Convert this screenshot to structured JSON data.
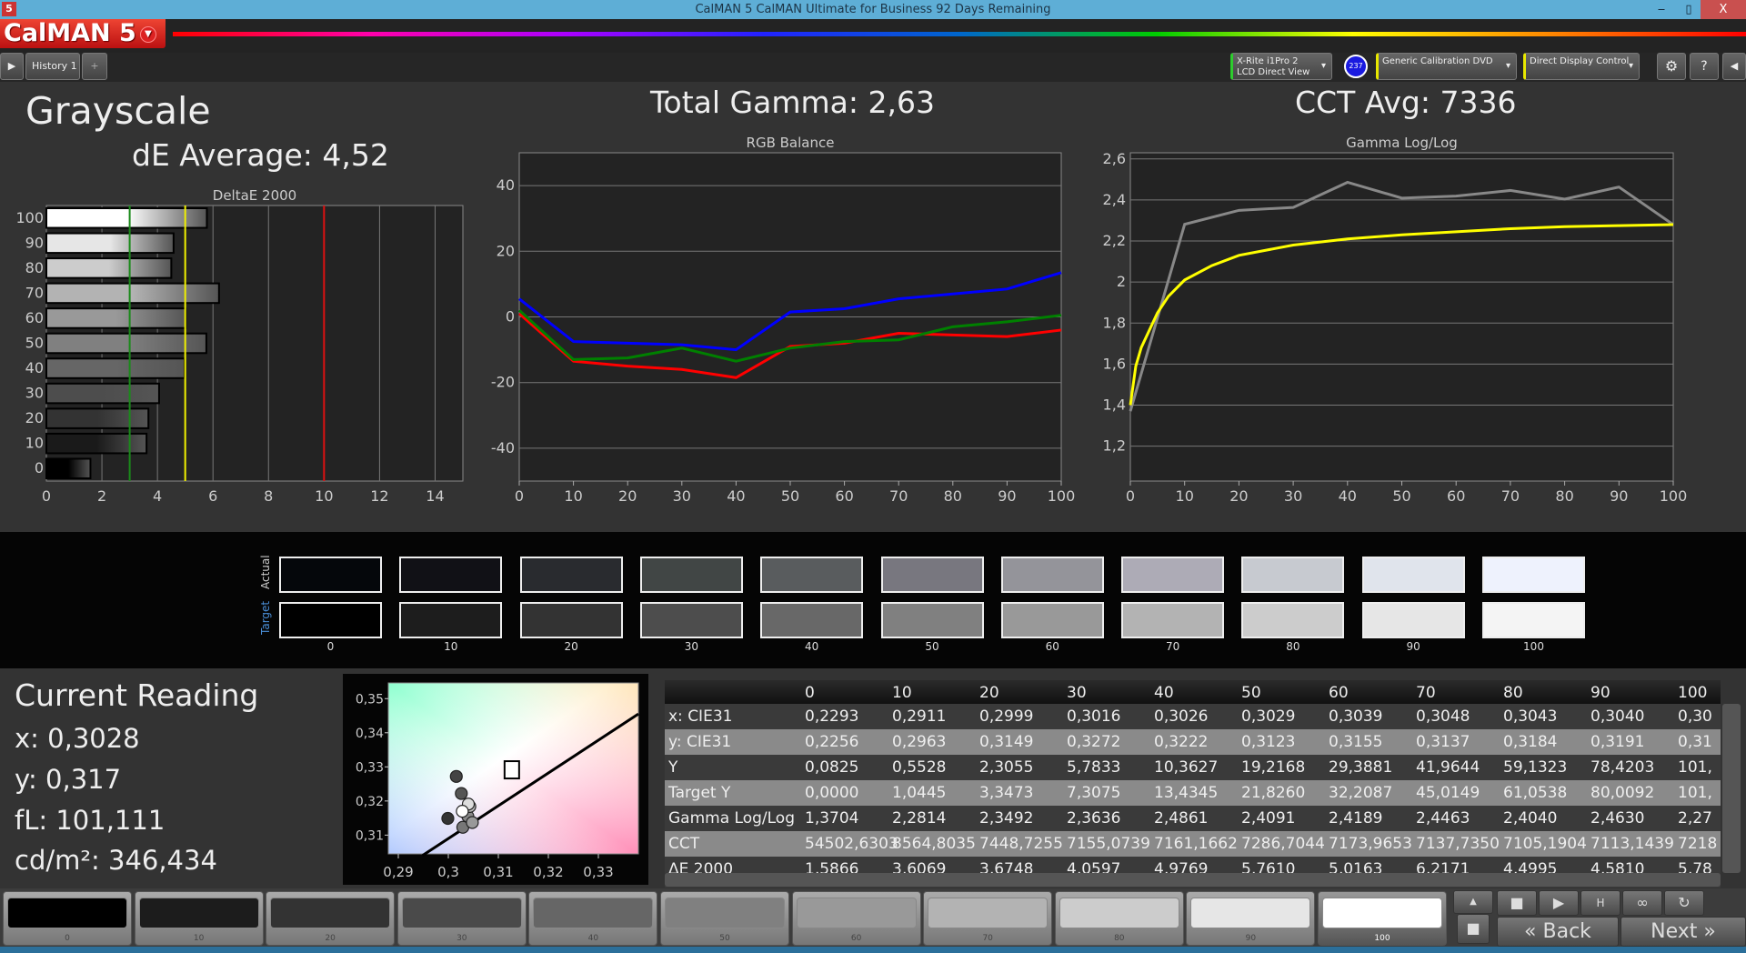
{
  "window": {
    "title": "CalMAN 5 CalMAN Ultimate for Business 92 Days Remaining",
    "app_icon": "5",
    "minimize": "‒",
    "restore": "▯",
    "close": "X"
  },
  "logo": {
    "text": "CalMAN 5",
    "menu_icon": "chevron-down"
  },
  "tabs": {
    "items": [
      {
        "label": "History 1"
      }
    ],
    "add": "+"
  },
  "toolbar": {
    "meter_line1": "X-Rite i1Pro 2",
    "meter_line2": "LCD Direct View",
    "meter_badge": "237",
    "source": "Generic Calibration DVD",
    "display": "Direct Display Control",
    "accent_meter": "#2ecc2e",
    "accent_source": "#e8e800",
    "accent_display": "#e8e800"
  },
  "header": {
    "page_title": "Grayscale",
    "de_average": "dE Average: 4,52",
    "total_gamma": "Total Gamma: 2,63",
    "cct_avg": "CCT Avg: 7336"
  },
  "chart_data": [
    {
      "type": "bar",
      "orientation": "horizontal",
      "title": "DeltaE 2000",
      "categories": [
        "0",
        "10",
        "20",
        "30",
        "40",
        "50",
        "60",
        "70",
        "80",
        "90",
        "100"
      ],
      "values": [
        1.5866,
        3.6069,
        3.6748,
        4.0597,
        4.9769,
        5.761,
        5.0163,
        6.2171,
        4.4995,
        4.581,
        5.78
      ],
      "xlim": [
        0,
        15
      ],
      "xticks": [
        "0",
        "2",
        "4",
        "6",
        "8",
        "10",
        "12",
        "14"
      ],
      "thresholds": [
        {
          "value": 3,
          "color": "#1a8a1a"
        },
        {
          "value": 5,
          "color": "#f0f000"
        },
        {
          "value": 10,
          "color": "#dd1111"
        }
      ],
      "grid": true
    },
    {
      "type": "line",
      "title": "RGB Balance",
      "x": [
        0,
        10,
        20,
        30,
        40,
        50,
        60,
        70,
        80,
        90,
        100
      ],
      "series": [
        {
          "color": "#ff0000",
          "values": [
            1,
            -13.5,
            -15,
            -16,
            -18.5,
            -9,
            -8,
            -5,
            -5.5,
            -6,
            -4
          ]
        },
        {
          "color": "#008000",
          "values": [
            2,
            -13,
            -12.5,
            -9.5,
            -13.5,
            -9.5,
            -7.5,
            -7,
            -3,
            -1.5,
            0.5
          ]
        },
        {
          "color": "#0000ff",
          "values": [
            5.5,
            -7.5,
            -8,
            -8.5,
            -10,
            1.5,
            2.5,
            5.5,
            7,
            8.5,
            13.5
          ]
        }
      ],
      "ylim": [
        -50,
        50
      ],
      "yticks": [
        "40",
        "20",
        "0",
        "-20",
        "-40"
      ],
      "xticks": [
        "0",
        "10",
        "20",
        "30",
        "40",
        "50",
        "60",
        "70",
        "80",
        "90",
        "100"
      ],
      "grid": true
    },
    {
      "type": "line",
      "title": "Gamma Log/Log",
      "series": [
        {
          "color": "#888888",
          "x": [
            0,
            10,
            20,
            30,
            40,
            50,
            60,
            70,
            80,
            90,
            100
          ],
          "values": [
            1.3704,
            2.2814,
            2.3492,
            2.3636,
            2.4861,
            2.4091,
            2.4189,
            2.4463,
            2.404,
            2.463,
            2.28
          ]
        },
        {
          "color": "#ffff00",
          "x": [
            0,
            1,
            2,
            5,
            7,
            10,
            15,
            20,
            30,
            40,
            50,
            60,
            70,
            80,
            90,
            100
          ],
          "values": [
            1.4,
            1.59,
            1.68,
            1.85,
            1.93,
            2.01,
            2.08,
            2.13,
            2.18,
            2.21,
            2.23,
            2.245,
            2.26,
            2.27,
            2.275,
            2.28
          ]
        }
      ],
      "ylim": [
        1.03,
        2.63
      ],
      "yticks": [
        "2,6",
        "2,4",
        "2,2",
        "2",
        "1,8",
        "1,6",
        "1,4",
        "1,2"
      ],
      "xticks": [
        "0",
        "10",
        "20",
        "30",
        "40",
        "50",
        "60",
        "70",
        "80",
        "90",
        "100"
      ],
      "grid": true
    },
    {
      "type": "scatter",
      "title": "",
      "xlim": [
        0.288,
        0.338
      ],
      "ylim": [
        0.3045,
        0.3546
      ],
      "xticks": [
        "0,29",
        "0,3",
        "0,31",
        "0,32",
        "0,33"
      ],
      "yticks": [
        "0,35",
        "0,34",
        "0,33",
        "0,32",
        "0,31"
      ],
      "points": [
        {
          "x": 0.2999,
          "y": 0.3149,
          "color": "#333333"
        },
        {
          "x": 0.3016,
          "y": 0.3272,
          "color": "#444444"
        },
        {
          "x": 0.3026,
          "y": 0.3222,
          "color": "#555555"
        },
        {
          "x": 0.3029,
          "y": 0.3123,
          "color": "#777777"
        },
        {
          "x": 0.3039,
          "y": 0.3155,
          "color": "#888888"
        },
        {
          "x": 0.3048,
          "y": 0.3137,
          "color": "#999999"
        },
        {
          "x": 0.3043,
          "y": 0.3184,
          "color": "#bbbbbb"
        },
        {
          "x": 0.304,
          "y": 0.3191,
          "color": "#dddddd"
        },
        {
          "x": 0.3028,
          "y": 0.317,
          "color": "#ffffff"
        }
      ],
      "target": {
        "x": 0.3127,
        "y": 0.329
      },
      "locus": [
        [
          0.2948,
          0.304
        ],
        [
          0.338,
          0.3455
        ]
      ]
    }
  ],
  "swatches": {
    "labels": [
      "Actual",
      "Target"
    ],
    "levels": [
      "0",
      "10",
      "20",
      "30",
      "40",
      "50",
      "60",
      "70",
      "80",
      "90",
      "100"
    ],
    "actual": [
      "#05070b",
      "#111116",
      "#292b2f",
      "#414645",
      "#595c5e",
      "#78777f",
      "#94949a",
      "#adabb6",
      "#c7cad0",
      "#e0e4ec",
      "#eef2fd"
    ],
    "target": [
      "#000000",
      "#1d1d1d",
      "#333333",
      "#4d4d4d",
      "#686868",
      "#808080",
      "#999999",
      "#b3b3b3",
      "#cccccc",
      "#e6e6e6",
      "#f4f4f4"
    ]
  },
  "reading": {
    "title": "Current Reading",
    "x": "x: 0,3028",
    "y": "y: 0,317",
    "fl": "fL: 101,111",
    "cdm2": "cd/m²: 346,434"
  },
  "table": {
    "columns": [
      "0",
      "10",
      "20",
      "30",
      "40",
      "50",
      "60",
      "70",
      "80",
      "90",
      "100"
    ],
    "rows": [
      {
        "label": "x: CIE31",
        "values": [
          "0,2293",
          "0,2911",
          "0,2999",
          "0,3016",
          "0,3026",
          "0,3029",
          "0,3039",
          "0,3048",
          "0,3043",
          "0,3040",
          "0,30"
        ]
      },
      {
        "label": "y: CIE31",
        "values": [
          "0,2256",
          "0,2963",
          "0,3149",
          "0,3272",
          "0,3222",
          "0,3123",
          "0,3155",
          "0,3137",
          "0,3184",
          "0,3191",
          "0,31"
        ]
      },
      {
        "label": "Y",
        "values": [
          "0,0825",
          "0,5528",
          "2,3055",
          "5,7833",
          "10,3627",
          "19,2168",
          "29,3881",
          "41,9644",
          "59,1323",
          "78,4203",
          "101,"
        ]
      },
      {
        "label": "Target Y",
        "values": [
          "0,0000",
          "1,0445",
          "3,3473",
          "7,3075",
          "13,4345",
          "21,8260",
          "32,2087",
          "45,0149",
          "61,0538",
          "80,0092",
          "101,"
        ]
      },
      {
        "label": "Gamma Log/Log",
        "values": [
          "1,3704",
          "2,2814",
          "2,3492",
          "2,3636",
          "2,4861",
          "2,4091",
          "2,4189",
          "2,4463",
          "2,4040",
          "2,4630",
          "2,27"
        ]
      },
      {
        "label": "CCT",
        "values": [
          "54502,6303",
          "8564,8035",
          "7448,7255",
          "7155,0739",
          "7161,1662",
          "7286,7044",
          "7173,9653",
          "7137,7350",
          "7105,1904",
          "7113,1439",
          "7218"
        ]
      },
      {
        "label": "ΔE 2000",
        "values": [
          "1,5866",
          "3,6069",
          "3,6748",
          "4,0597",
          "4,9769",
          "5,7610",
          "5,0163",
          "6,2171",
          "4,4995",
          "4,5810",
          "5,78"
        ]
      }
    ]
  },
  "patches": {
    "levels": [
      "0",
      "10",
      "20",
      "30",
      "40",
      "50",
      "60",
      "70",
      "80",
      "90",
      "100"
    ],
    "colors": [
      "#000000",
      "#1c1c1c",
      "#333333",
      "#4a4a4a",
      "#666666",
      "#808080",
      "#999999",
      "#b3b3b3",
      "#cccccc",
      "#e6e6e6",
      "#ffffff"
    ],
    "selected": "100"
  },
  "nav": {
    "back": "Back",
    "next": "Next"
  }
}
